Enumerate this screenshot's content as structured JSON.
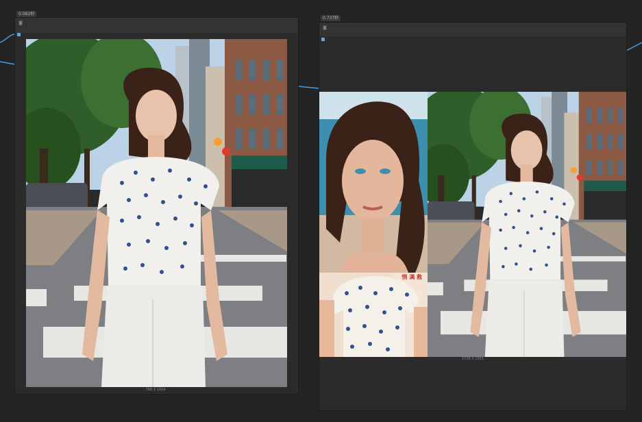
{
  "nodes": [
    {
      "id": "preview-1",
      "time": "0.082秒",
      "size": "768 X 1024"
    },
    {
      "id": "preview-2",
      "time": "0.737秒",
      "size": "1728 X 1551"
    }
  ],
  "collage_overlay_text": "悄 满 救",
  "colors": {
    "canvas": "#242424",
    "node_body": "#2b2b2b",
    "node_header": "#333333",
    "wire": "#4a9de0",
    "port": "#5aa9e6"
  },
  "images": [
    {
      "subject": "woman-walking-street-photo"
    },
    {
      "subject": "woman-face-closeup-photo"
    },
    {
      "subject": "woman-torso-closeup-photo"
    },
    {
      "subject": "woman-walking-street-photo-copy"
    }
  ]
}
